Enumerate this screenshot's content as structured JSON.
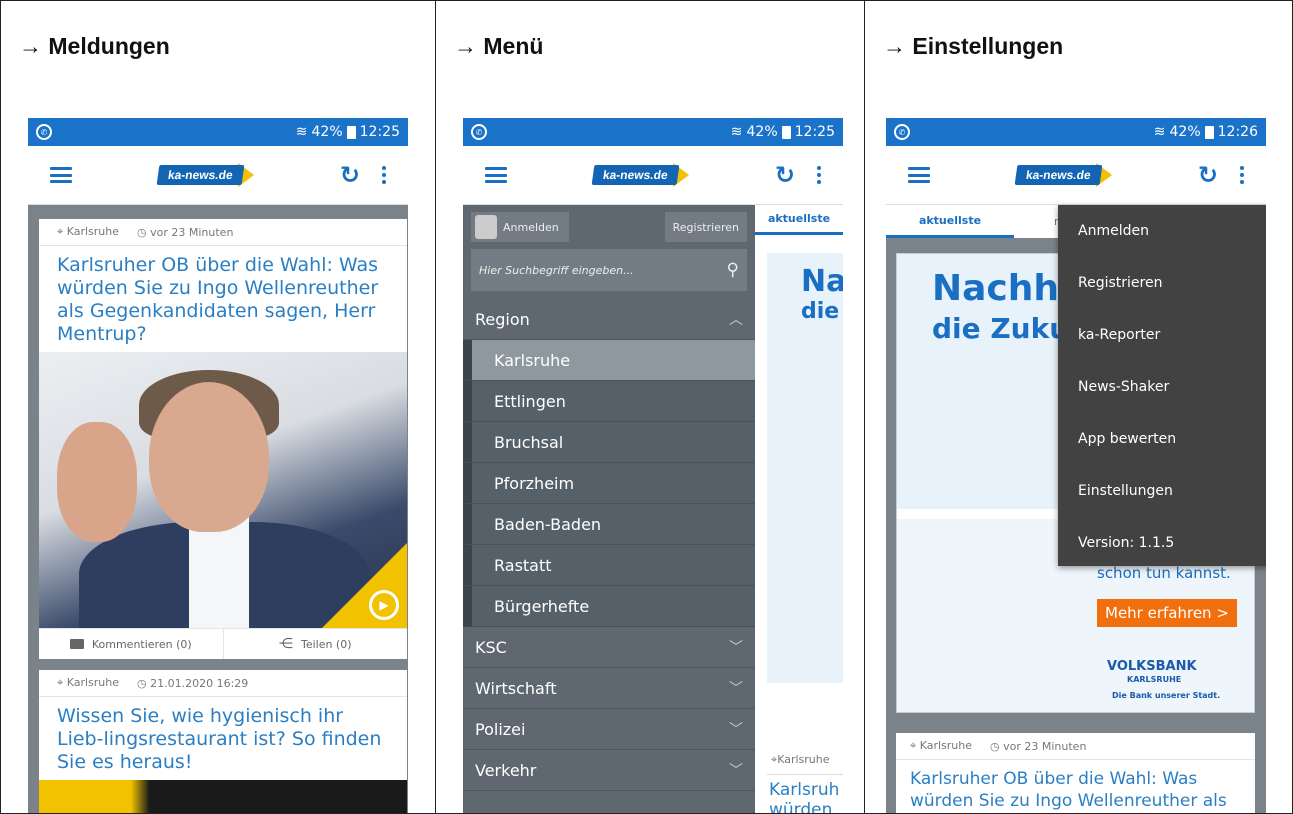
{
  "panels": [
    {
      "heading": "→ Meldungen"
    },
    {
      "heading": "→ Menü"
    },
    {
      "heading": "→ Einstellungen"
    }
  ],
  "status": {
    "battery": "42%",
    "times": [
      "12:25",
      "12:25",
      "12:26"
    ]
  },
  "appbar": {
    "logo": "ka-news.de"
  },
  "feed": {
    "card1": {
      "location": "Karlsruhe",
      "time": "vor 23 Minuten",
      "title": "Karlsruher OB über die Wahl: Was würden Sie zu Ingo Wellenreuther als Gegenkandidaten sagen, Herr Mentrup?",
      "comments": "Kommentieren (0)",
      "share": "Teilen (0)"
    },
    "card2": {
      "location": "Karlsruhe",
      "time": "21.01.2020 16:29",
      "title": "Wissen Sie, wie hygienisch ihr Lieb-lingsrestaurant ist? So finden Sie es heraus!"
    }
  },
  "drawer": {
    "login": "Anmelden",
    "register": "Registrieren",
    "search_placeholder": "Hier Suchbegriff eingeben...",
    "region": "Region",
    "subitems": [
      "Karlsruhe",
      "Ettlingen",
      "Bruchsal",
      "Pforzheim",
      "Baden-Baden",
      "Rastatt",
      "Bürgerhefte"
    ],
    "categories": [
      "KSC",
      "Wirtschaft",
      "Polizei",
      "Verkehr"
    ],
    "behind_tab": "aktuellste",
    "behind_ad_big": "Na",
    "behind_ad_small": "die",
    "behind_location": "Karlsruhe",
    "behind_title": "Karlsruh würden"
  },
  "settings": {
    "tab_active": "aktuellste",
    "tab_next": "me",
    "ad_title_1": "Nachha",
    "ad_title_2": "die Zukun",
    "ad_tagline": "schon tun kannst.",
    "ad_button": "Mehr erfahren >",
    "ad_bank": "VOLKSBANK",
    "ad_bank_city": "KARLSRUHE",
    "ad_bank_slogan": "Die Bank unserer Stadt.",
    "menu": [
      "Anmelden",
      "Registrieren",
      "ka-Reporter",
      "News-Shaker",
      "App bewerten",
      "Einstellungen",
      "Version: 1.1.5"
    ],
    "card_location": "Karlsruhe",
    "card_time": "vor 23 Minuten",
    "card_title": "Karlsruher OB über die Wahl: Was würden Sie zu Ingo Wellenreuther als"
  }
}
